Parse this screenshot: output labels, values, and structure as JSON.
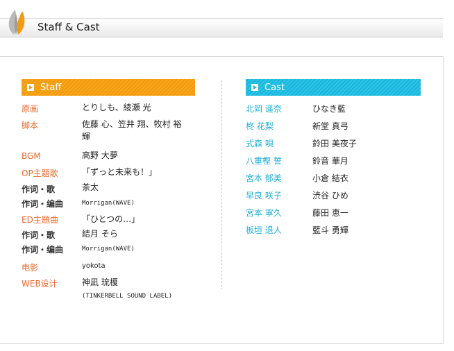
{
  "header": {
    "title": "Staff & Cast"
  },
  "staff": {
    "heading": "Staff",
    "rows": [
      {
        "label": "原画",
        "value": "とりしも、綾瀬 光",
        "label_style": "orange"
      },
      {
        "label": "脚本",
        "value": "佐藤 心、笠井 翔、牧村 裕輝",
        "label_style": "orange"
      },
      {
        "label": "BGM",
        "value": "高野 大夢",
        "label_style": "orange"
      },
      {
        "label": "OP主題歌",
        "value": "「ずっと未来も！」",
        "label_style": "orange"
      },
      {
        "label": "作词・歌",
        "value": "茶太",
        "label_style": "dark"
      },
      {
        "label": "作词・编曲",
        "value": "Morrigan(WAVE)",
        "label_style": "dark"
      },
      {
        "label": "ED主題曲",
        "value": "「ひとつの…」",
        "label_style": "orange"
      },
      {
        "label": "作词・歌",
        "value": "結月 そら",
        "label_style": "dark"
      },
      {
        "label": "作词・编曲",
        "value": "Morrigan(WAVE)",
        "label_style": "dark"
      },
      {
        "label": "电影",
        "value": "yokota",
        "label_style": "orange"
      },
      {
        "label": "WEB设计",
        "value": "神凪 琉榎",
        "sub": "(TINKERBELL SOUND LABEL)",
        "label_style": "orange"
      }
    ]
  },
  "cast": {
    "heading": "Cast",
    "rows": [
      {
        "role": "北岡 遥奈",
        "actor": "ひなき藍"
      },
      {
        "role": "柊 花梨",
        "actor": "新堂 真弓"
      },
      {
        "role": "式森 唄",
        "actor": "鈴田 美夜子"
      },
      {
        "role": "八重樫 誓",
        "actor": "鈴音 華月"
      },
      {
        "role": "宮本 郁美",
        "actor": "小倉 結衣"
      },
      {
        "role": "早良 咲子",
        "actor": "渋谷 ひめ"
      },
      {
        "role": "宮本 寧久",
        "actor": "藤田 恵一"
      },
      {
        "role": "板垣 退人",
        "actor": "藍斗 勇輝"
      }
    ]
  }
}
